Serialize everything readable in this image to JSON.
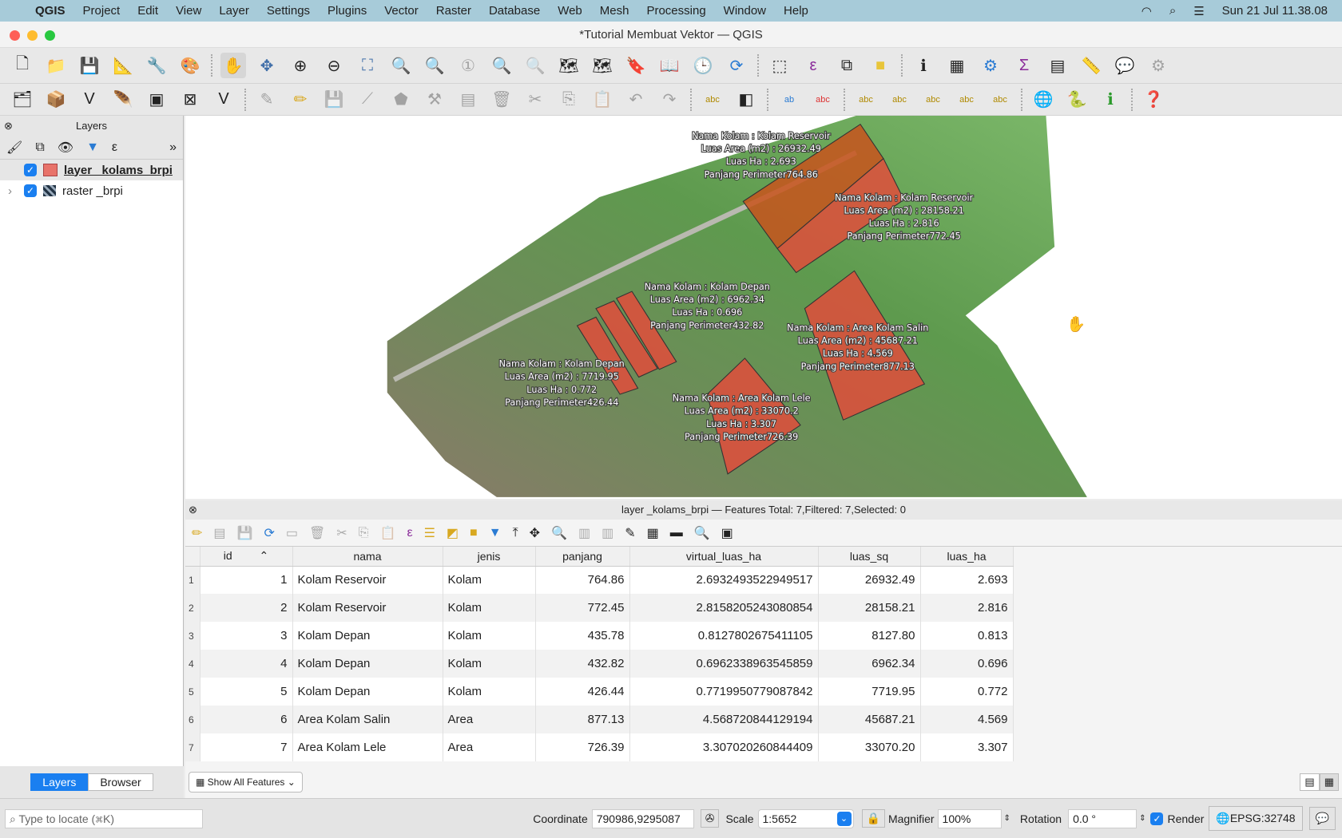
{
  "menubar": {
    "app": "QGIS",
    "items": [
      "Project",
      "Edit",
      "View",
      "Layer",
      "Settings",
      "Plugins",
      "Vector",
      "Raster",
      "Database",
      "Web",
      "Mesh",
      "Processing",
      "Window",
      "Help"
    ],
    "clock": "Sun 21 Jul  11.38.08"
  },
  "window": {
    "title": "*Tutorial Membuat Vektor — QGIS"
  },
  "layers_panel": {
    "title": "Layers",
    "layers": [
      {
        "name": "layer _kolams_brpi",
        "checked": true,
        "color": "#e8736a"
      },
      {
        "name": "raster _brpi",
        "checked": true
      }
    ],
    "tabs": [
      "Layers",
      "Browser"
    ]
  },
  "map": {
    "labels": [
      {
        "lines": [
          "Nama Kolam : Kolam Reservoir",
          "Luas Area (m2) : 26932.49",
          "Luas Ha : 2.693",
          "Panjang Perimeter764.86"
        ]
      },
      {
        "lines": [
          "Nama Kolam : Kolam Reservoir",
          "Luas Area (m2) : 28158.21",
          "Luas Ha : 2.816",
          "Panjang Perimeter772.45"
        ]
      },
      {
        "lines": [
          "Nama Kolam : Kolam Depan",
          "Luas Area (m2) : 6962.34",
          "Luas Ha : 0.696",
          "Panjang Perimeter432.82"
        ]
      },
      {
        "lines": [
          "Nama Kolam : Kolam Depan",
          "Luas Area (m2) : 7719.95",
          "Luas Ha : 0.772",
          "Panjang Perimeter426.44"
        ]
      },
      {
        "lines": [
          "Nama Kolam : Area Kolam Salin",
          "Luas Area (m2) : 45687.21",
          "Luas Ha : 4.569",
          "Panjang Perimeter877.13"
        ]
      },
      {
        "lines": [
          "Nama Kolam : Area Kolam Lele",
          "Luas Area (m2) : 33070.2",
          "Luas Ha : 3.307",
          "Panjang Perimeter726.39"
        ]
      }
    ],
    "feature_color": "#e8483a"
  },
  "attribute_table": {
    "title": "layer _kolams_brpi — Features Total: 7,Filtered: 7,Selected: 0",
    "columns": [
      "id",
      "nama",
      "jenis",
      "panjang",
      "virtual_luas_ha",
      "luas_sq",
      "luas_ha"
    ],
    "rows": [
      [
        "1",
        "Kolam Reservoir",
        "Kolam",
        "764.86",
        "2.6932493522949517",
        "26932.49",
        "2.693"
      ],
      [
        "2",
        "Kolam Reservoir",
        "Kolam",
        "772.45",
        "2.8158205243080854",
        "28158.21",
        "2.816"
      ],
      [
        "3",
        "Kolam Depan",
        "Kolam",
        "435.78",
        "0.8127802675411105",
        "8127.80",
        "0.813"
      ],
      [
        "4",
        "Kolam Depan",
        "Kolam",
        "432.82",
        "0.6962338963545859",
        "6962.34",
        "0.696"
      ],
      [
        "5",
        "Kolam Depan",
        "Kolam",
        "426.44",
        "0.7719950779087842",
        "7719.95",
        "0.772"
      ],
      [
        "6",
        "Area Kolam Salin",
        "Area",
        "877.13",
        "4.568720844129194",
        "45687.21",
        "4.569"
      ],
      [
        "7",
        "Area Kolam Lele",
        "Area",
        "726.39",
        "3.307020260844409",
        "33070.20",
        "3.307"
      ]
    ],
    "show_features": "Show All Features"
  },
  "statusbar": {
    "locate_placeholder": "Type to locate (⌘K)",
    "coordinate_label": "Coordinate",
    "coordinate": "790986,9295087",
    "scale_label": "Scale",
    "scale": "1:5652",
    "magnifier_label": "Magnifier",
    "magnifier": "100%",
    "rotation_label": "Rotation",
    "rotation": "0.0 °",
    "render_label": "Render",
    "crs": "EPSG:32748"
  }
}
